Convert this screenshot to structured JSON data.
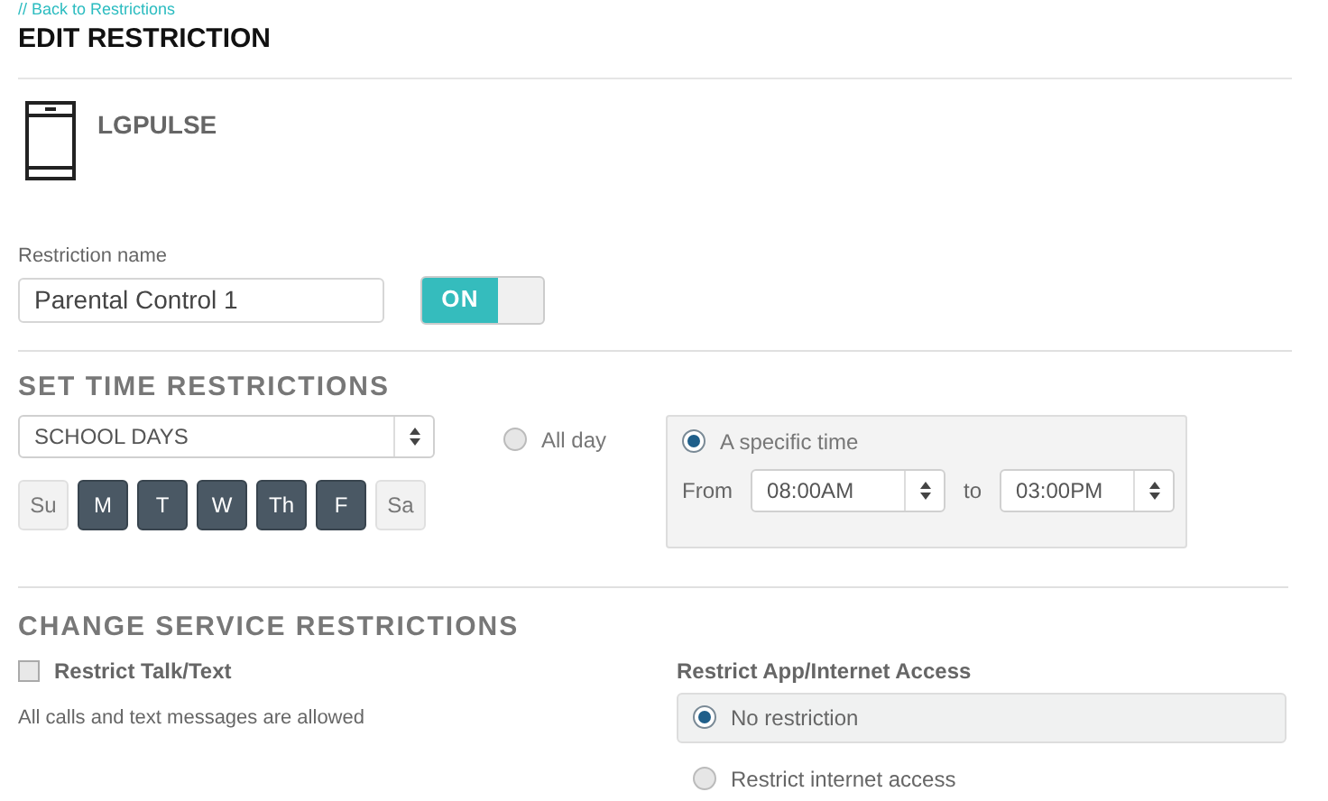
{
  "back_link": "// Back to Restrictions",
  "title": "EDIT RESTRICTION",
  "device": {
    "name": "LGPULSE"
  },
  "restriction_name": {
    "label": "Restriction name",
    "value": "Parental Control 1"
  },
  "toggle": {
    "label": "ON",
    "on": true
  },
  "time_section": {
    "heading": "SET TIME RESTRICTIONS",
    "schedule": "SCHOOL DAYS",
    "days": [
      {
        "label": "Su",
        "selected": false
      },
      {
        "label": "M",
        "selected": true
      },
      {
        "label": "T",
        "selected": true
      },
      {
        "label": "W",
        "selected": true
      },
      {
        "label": "Th",
        "selected": true
      },
      {
        "label": "F",
        "selected": true
      },
      {
        "label": "Sa",
        "selected": false
      }
    ],
    "all_day": {
      "label": "All day",
      "selected": false
    },
    "specific_time": {
      "label": "A specific time",
      "selected": true,
      "from_label": "From",
      "from": "08:00AM",
      "to_label": "to",
      "to": "03:00PM"
    }
  },
  "service_section": {
    "heading": "CHANGE SERVICE RESTRICTIONS",
    "talk_text": {
      "label": "Restrict Talk/Text",
      "checked": false,
      "note": "All calls and text messages are allowed"
    },
    "internet": {
      "heading": "Restrict App/Internet Access",
      "options": [
        {
          "label": "No restriction",
          "selected": true
        },
        {
          "label": "Restrict internet access",
          "selected": false
        }
      ]
    }
  }
}
